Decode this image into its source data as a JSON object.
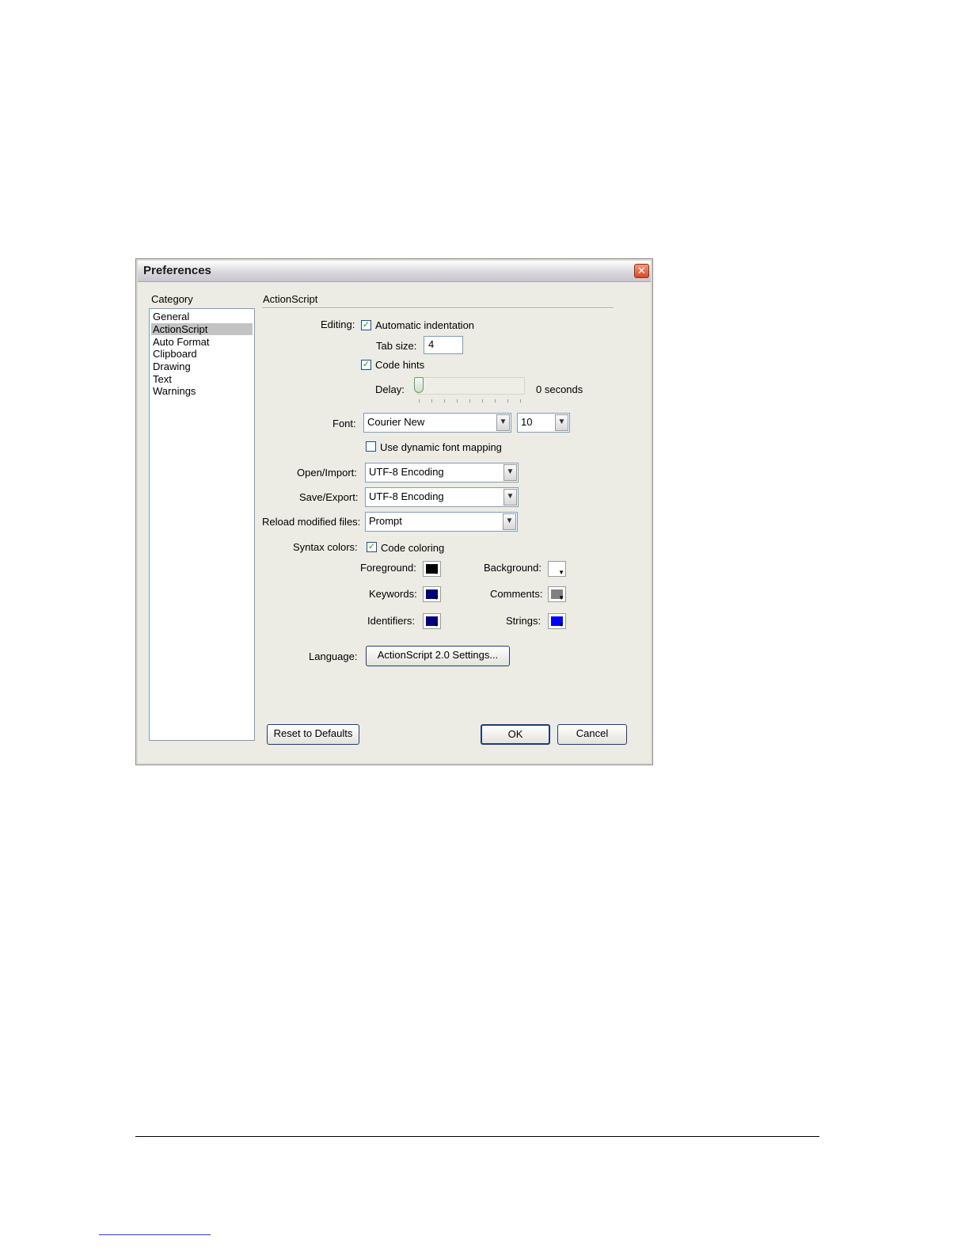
{
  "dialog": {
    "title": "Preferences",
    "close_icon": "close-icon"
  },
  "category": {
    "label": "Category",
    "items": [
      "General",
      "ActionScript",
      "Auto Format",
      "Clipboard",
      "Drawing",
      "Text",
      "Warnings"
    ],
    "selected": "ActionScript"
  },
  "section_title": "ActionScript",
  "editing": {
    "label": "Editing:",
    "auto_indent_label": "Automatic indentation",
    "auto_indent_checked": true,
    "tab_size_label": "Tab size:",
    "tab_size_value": "4",
    "code_hints_label": "Code hints",
    "code_hints_checked": true,
    "delay_label": "Delay:",
    "delay_value_text": "0 seconds",
    "delay_level": 0
  },
  "font": {
    "label": "Font:",
    "family": "Courier New",
    "size": "10",
    "dynamic_mapping_label": "Use dynamic font mapping",
    "dynamic_mapping_checked": false
  },
  "encoding": {
    "open_label": "Open/Import:",
    "open_value": "UTF-8 Encoding",
    "save_label": "Save/Export:",
    "save_value": "UTF-8 Encoding",
    "reload_label": "Reload modified files:",
    "reload_value": "Prompt"
  },
  "syntax": {
    "label": "Syntax colors:",
    "code_coloring_label": "Code coloring",
    "code_coloring_checked": true,
    "foreground_label": "Foreground:",
    "foreground_color": "#000000",
    "background_label": "Background:",
    "background_color": "#ffffff",
    "keywords_label": "Keywords:",
    "keywords_color": "#00007d",
    "comments_label": "Comments:",
    "comments_color": "#808080",
    "identifiers_label": "Identifiers:",
    "identifiers_color": "#00007d",
    "strings_label": "Strings:",
    "strings_color": "#0000ff"
  },
  "language": {
    "label": "Language:",
    "settings_button": "ActionScript 2.0 Settings..."
  },
  "buttons": {
    "reset": "Reset to Defaults",
    "ok": "OK",
    "cancel": "Cancel"
  }
}
